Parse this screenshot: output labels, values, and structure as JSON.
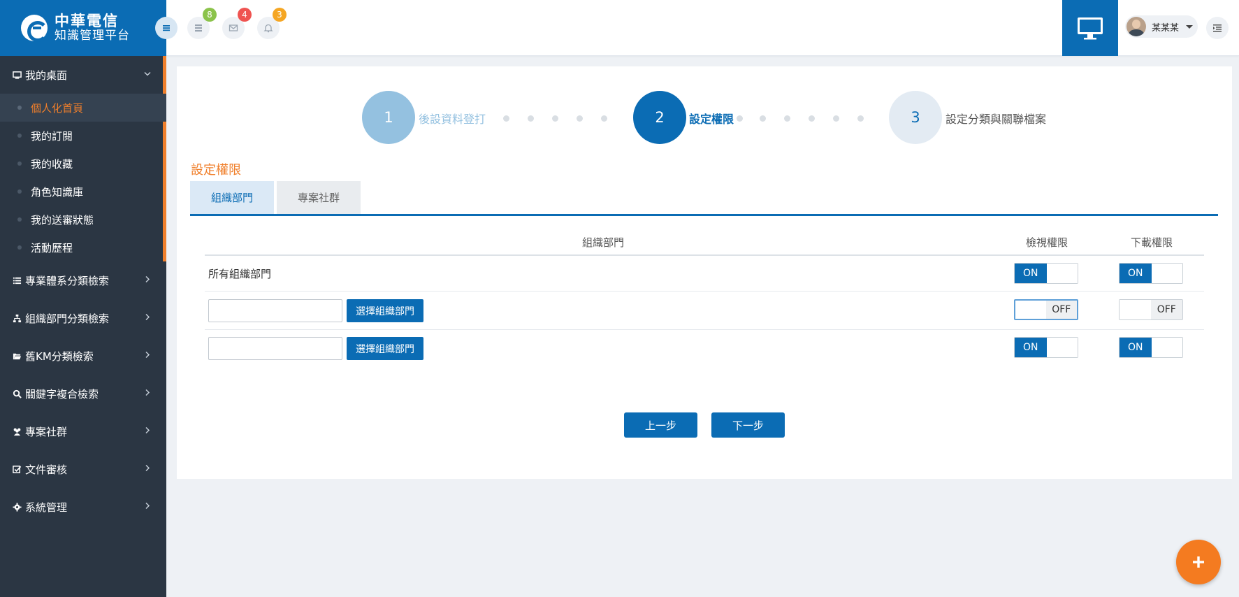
{
  "brand": {
    "line1": "中華電信",
    "line2": "知識管理平台"
  },
  "topbar": {
    "badges": {
      "tasks": "8",
      "messages": "4",
      "notifications": "3"
    },
    "badge_colors": {
      "tasks": "#8bc34a",
      "messages": "#ef5350",
      "notifications": "#f5a623"
    },
    "user_name": "某某某"
  },
  "sidebar": {
    "desktop": {
      "label": "我的桌面",
      "icon": "desktop-icon"
    },
    "sub_items": [
      {
        "label": "個人化首頁",
        "active": true
      },
      {
        "label": "我的訂閱"
      },
      {
        "label": "我的收藏"
      },
      {
        "label": "角色知識庫"
      },
      {
        "label": "我的送審狀態"
      },
      {
        "label": "活動歷程"
      }
    ],
    "sections": [
      {
        "label": "專業體系分類檢索",
        "icon": "list-icon"
      },
      {
        "label": "組織部門分類檢索",
        "icon": "sitemap-icon"
      },
      {
        "label": "舊KM分類檢索",
        "icon": "folder-open-icon"
      },
      {
        "label": "關鍵字複合檢索",
        "icon": "search-icon"
      },
      {
        "label": "專案社群",
        "icon": "users-icon"
      },
      {
        "label": "文件審核",
        "icon": "check-square-icon"
      },
      {
        "label": "系統管理",
        "icon": "gear-icon"
      }
    ]
  },
  "steps": [
    {
      "num": "1",
      "label": "後設資料登打",
      "state": "done"
    },
    {
      "num": "2",
      "label": "設定權限",
      "state": "current"
    },
    {
      "num": "3",
      "label": "設定分類與關聯檔案",
      "state": "pending"
    }
  ],
  "section_title": "設定權限",
  "tabs": [
    {
      "label": "組織部門",
      "active": true
    },
    {
      "label": "專案社群",
      "active": false
    }
  ],
  "table": {
    "headers": {
      "dept": "組織部門",
      "view": "檢視權限",
      "download": "下載權限"
    },
    "rows": [
      {
        "label": "所有組織部門",
        "view": "ON",
        "download": "ON"
      },
      {
        "input": "",
        "button": "選擇組織部門",
        "view": "OFF",
        "download": "OFF"
      },
      {
        "input": "",
        "button": "選擇組織部門",
        "view": "ON",
        "download": "ON"
      }
    ]
  },
  "buttons": {
    "prev": "上一步",
    "next": "下一步"
  },
  "colors": {
    "primary": "#0b6cb4",
    "accent": "#f07f2b",
    "sidebar": "#2b3643"
  }
}
